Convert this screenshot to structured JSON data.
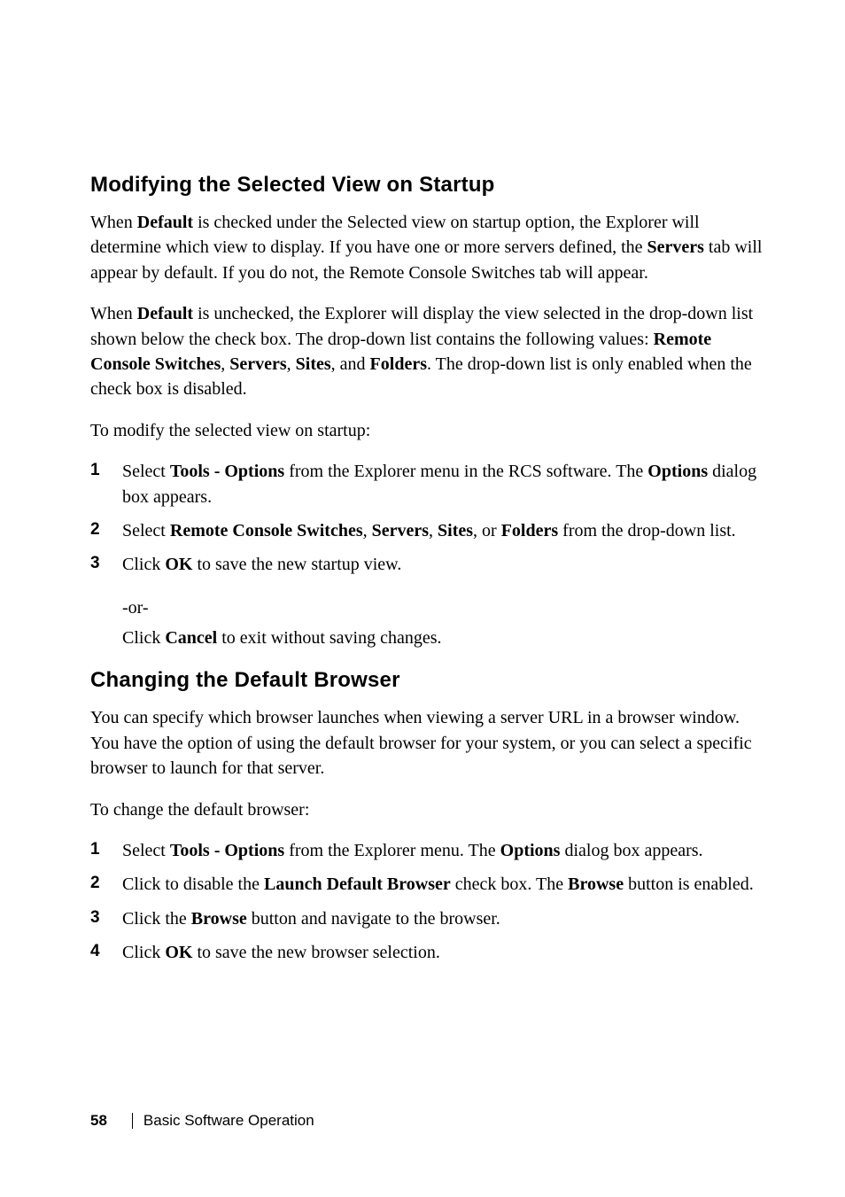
{
  "section1": {
    "heading": "Modifying the Selected View on Startup",
    "p1_a": "When ",
    "p1_b": "Default",
    "p1_c": " is checked under the Selected view on startup option, the Explorer will determine which view to display. If you have one or more servers defined, the ",
    "p1_d": "Servers",
    "p1_e": " tab will appear by default. If you do not, the Remote Console Switches tab will appear.",
    "p2_a": "When ",
    "p2_b": "Default",
    "p2_c": " is unchecked, the Explorer will display the view selected in the drop-down list shown below the check box. The drop-down list contains the following values: ",
    "p2_d": "Remote Console Switches",
    "p2_e": ", ",
    "p2_f": "Servers",
    "p2_g": ", ",
    "p2_h": "Sites",
    "p2_i": ", and ",
    "p2_j": "Folders",
    "p2_k": ". The drop-down list is only enabled when the check box is disabled.",
    "p3": "To modify the selected view on startup:",
    "steps": {
      "n1": "1",
      "s1_a": "Select ",
      "s1_b": "Tools - Options",
      "s1_c": " from the Explorer menu in the RCS software. The ",
      "s1_d": "Options",
      "s1_e": " dialog box appears.",
      "n2": "2",
      "s2_a": "Select ",
      "s2_b": "Remote Console Switches",
      "s2_c": ", ",
      "s2_d": "Servers",
      "s2_e": ", ",
      "s2_f": "Sites",
      "s2_g": ", or ",
      "s2_h": "Folders",
      "s2_i": " from the drop-down list.",
      "n3": "3",
      "s3_a": "Click ",
      "s3_b": "OK",
      "s3_c": " to save the new startup view.",
      "or": "-or-",
      "s3d_a": "Click ",
      "s3d_b": "Cancel",
      "s3d_c": " to exit without saving changes."
    }
  },
  "section2": {
    "heading": "Changing the Default Browser",
    "p1": "You can specify which browser launches when viewing a server URL in a browser window. You have the option of using the default browser for your system, or you can select a specific browser to launch for that server.",
    "p2": "To change the default browser:",
    "steps": {
      "n1": "1",
      "s1_a": "Select ",
      "s1_b": "Tools - Options",
      "s1_c": " from the Explorer menu. The ",
      "s1_d": "Options",
      "s1_e": " dialog box appears.",
      "n2": "2",
      "s2_a": "Click to disable the ",
      "s2_b": "Launch Default Browser",
      "s2_c": " check box. The ",
      "s2_d": "Browse",
      "s2_e": " button is enabled.",
      "n3": "3",
      "s3_a": "Click the ",
      "s3_b": "Browse",
      "s3_c": " button and navigate to the browser.",
      "n4": "4",
      "s4_a": "Click ",
      "s4_b": "OK",
      "s4_c": " to save the new browser selection."
    }
  },
  "footer": {
    "page": "58",
    "section": "Basic Software Operation"
  }
}
